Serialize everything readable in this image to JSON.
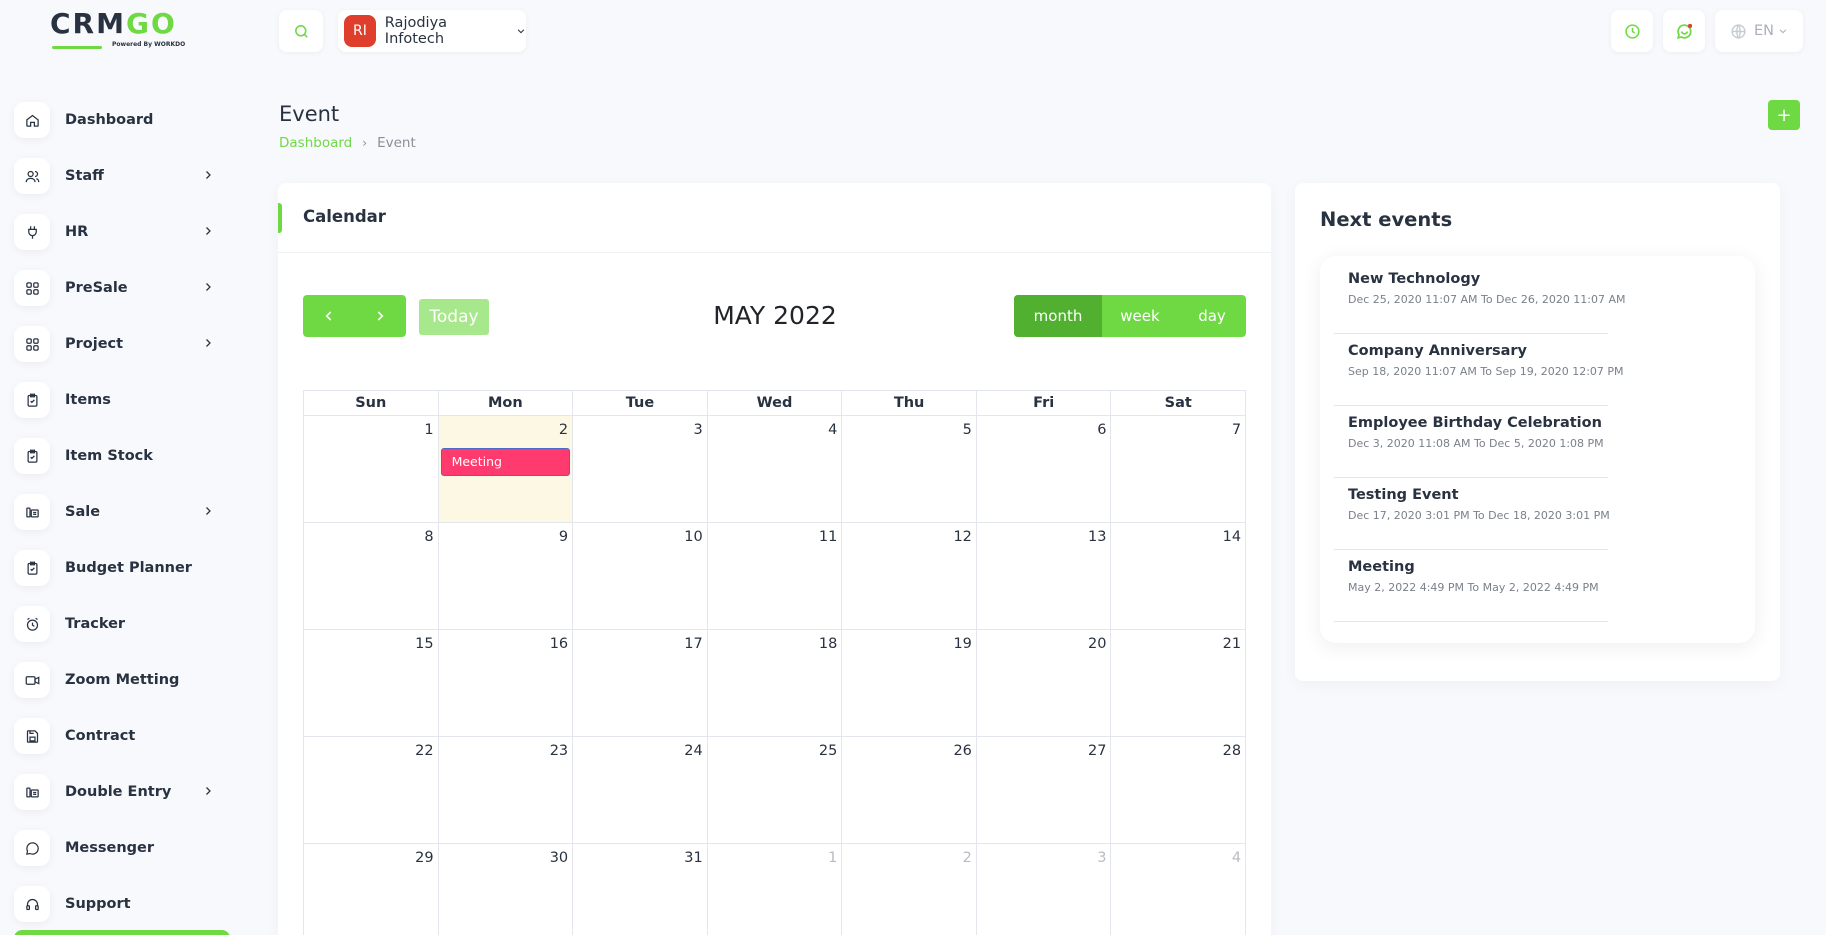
{
  "brand": {
    "logo_text_a": "CR",
    "logo_text_b": "M",
    "logo_text_c": "GO",
    "logo_sub": "Powered By WORKDO"
  },
  "sidebar": {
    "items": [
      {
        "label": "Dashboard",
        "icon": "home-icon",
        "has_children": false
      },
      {
        "label": "Staff",
        "icon": "users-icon",
        "has_children": true
      },
      {
        "label": "HR",
        "icon": "plug-icon",
        "has_children": true
      },
      {
        "label": "PreSale",
        "icon": "grid-icon",
        "has_children": true
      },
      {
        "label": "Project",
        "icon": "grid-icon",
        "has_children": true
      },
      {
        "label": "Items",
        "icon": "clipboard-icon",
        "has_children": false
      },
      {
        "label": "Item Stock",
        "icon": "clipboard-icon",
        "has_children": false
      },
      {
        "label": "Sale",
        "icon": "register-icon",
        "has_children": true
      },
      {
        "label": "Budget Planner",
        "icon": "clipboard-icon",
        "has_children": false
      },
      {
        "label": "Tracker",
        "icon": "alarm-icon",
        "has_children": false
      },
      {
        "label": "Zoom Metting",
        "icon": "video-icon",
        "has_children": false
      },
      {
        "label": "Contract",
        "icon": "save-icon",
        "has_children": false
      },
      {
        "label": "Double Entry",
        "icon": "register-icon",
        "has_children": true
      },
      {
        "label": "Messenger",
        "icon": "chat-icon",
        "has_children": false
      },
      {
        "label": "Support",
        "icon": "headset-icon",
        "has_children": false
      }
    ]
  },
  "topbar": {
    "company_initials": "RI",
    "company_name": "Rajodiya Infotech",
    "language": "EN"
  },
  "page": {
    "title": "Event",
    "breadcrumb": {
      "home": "Dashboard",
      "current": "Event"
    },
    "add_label": "+"
  },
  "calendar": {
    "card_title": "Calendar",
    "today_label": "Today",
    "month_title": "MAY 2022",
    "views": {
      "month": "month",
      "week": "week",
      "day": "day"
    },
    "weekdays": [
      "Sun",
      "Mon",
      "Tue",
      "Wed",
      "Thu",
      "Fri",
      "Sat"
    ],
    "weeks": [
      [
        "1",
        "2",
        "3",
        "4",
        "5",
        "6",
        "7"
      ],
      [
        "8",
        "9",
        "10",
        "11",
        "12",
        "13",
        "14"
      ],
      [
        "15",
        "16",
        "17",
        "18",
        "19",
        "20",
        "21"
      ],
      [
        "22",
        "23",
        "24",
        "25",
        "26",
        "27",
        "28"
      ],
      [
        "29",
        "30",
        "31",
        "1",
        "2",
        "3",
        "4"
      ]
    ],
    "event": {
      "label": "Meeting",
      "color": "#ff3a6e"
    }
  },
  "next_events": {
    "title": "Next events",
    "items": [
      {
        "name": "New Technology",
        "date": "Dec 25, 2020 11:07 AM To Dec 26, 2020 11:07 AM"
      },
      {
        "name": "Company Anniversary",
        "date": "Sep 18, 2020 11:07 AM To Sep 19, 2020 12:07 PM"
      },
      {
        "name": "Employee Birthday Celebration",
        "date": "Dec 3, 2020 11:08 AM To Dec 5, 2020 1:08 PM"
      },
      {
        "name": "Testing Event",
        "date": "Dec 17, 2020 3:01 PM To Dec 18, 2020 3:01 PM"
      },
      {
        "name": "Meeting",
        "date": "May 2, 2022 4:49 PM To May 2, 2022 4:49 PM"
      }
    ]
  },
  "colors": {
    "accent": "#6fd943",
    "accent_dark": "#51b030",
    "avatar": "#e03e2d",
    "today_bg": "#fcf8e3"
  }
}
